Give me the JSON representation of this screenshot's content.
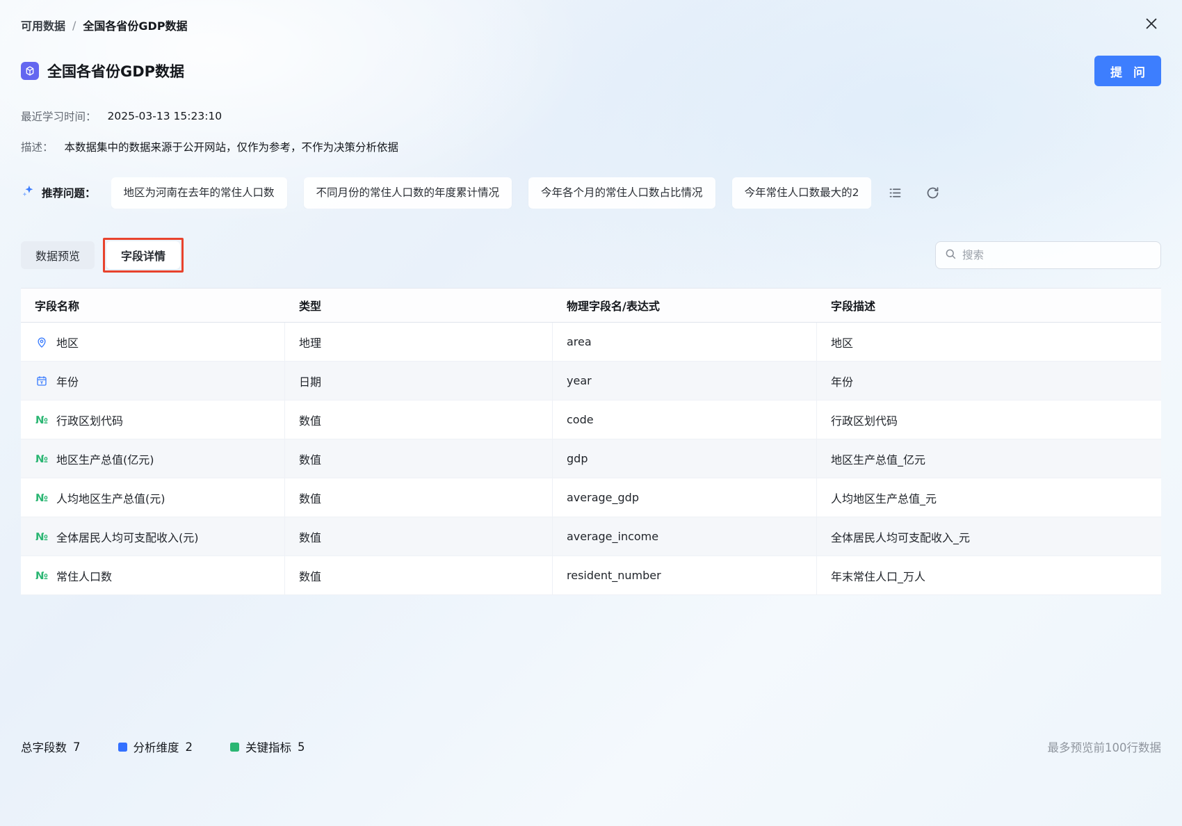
{
  "breadcrumb": {
    "parent": "可用数据",
    "separator": "/",
    "current": "全国各省份GDP数据"
  },
  "header": {
    "title": "全国各省份GDP数据",
    "ask_button": "提 问",
    "learn_time_label": "最近学习时间：",
    "learn_time_value": "2025-03-13 15:23:10",
    "desc_label": "描述：",
    "desc_value": "本数据集中的数据来源于公开网站，仅作为参考，不作为决策分析依据"
  },
  "recommend": {
    "label": "推荐问题：",
    "chips": [
      "地区为河南在去年的常住人口数",
      "不同月份的常住人口数的年度累计情况",
      "今年各个月的常住人口数占比情况",
      "今年常住人口数最大的2"
    ]
  },
  "tabs": [
    {
      "label": "数据预览",
      "active": false
    },
    {
      "label": "字段详情",
      "active": true
    }
  ],
  "search": {
    "placeholder": "搜索"
  },
  "table": {
    "headers": [
      "字段名称",
      "类型",
      "物理字段名/表达式",
      "字段描述"
    ],
    "rows": [
      {
        "icon": "location-pin",
        "name": "地区",
        "type": "地理",
        "physical": "area",
        "desc": "地区"
      },
      {
        "icon": "calendar",
        "name": "年份",
        "type": "日期",
        "physical": "year",
        "desc": "年份"
      },
      {
        "icon": "numeric",
        "name": "行政区划代码",
        "type": "数值",
        "physical": "code",
        "desc": "行政区划代码"
      },
      {
        "icon": "numeric",
        "name": "地区生产总值(亿元)",
        "type": "数值",
        "physical": "gdp",
        "desc": "地区生产总值_亿元"
      },
      {
        "icon": "numeric",
        "name": "人均地区生产总值(元)",
        "type": "数值",
        "physical": "average_gdp",
        "desc": "人均地区生产总值_元"
      },
      {
        "icon": "numeric",
        "name": "全体居民人均可支配收入(元)",
        "type": "数值",
        "physical": "average_income",
        "desc": "全体居民人均可支配收入_元"
      },
      {
        "icon": "numeric",
        "name": "常住人口数",
        "type": "数值",
        "physical": "resident_number",
        "desc": "年末常住人口_万人"
      }
    ]
  },
  "footer": {
    "total_label": "总字段数",
    "total_value": "7",
    "dimension_label": "分析维度",
    "dimension_value": "2",
    "metric_label": "关键指标",
    "metric_value": "5",
    "preview_note": "最多预览前100行数据"
  },
  "colors": {
    "accent_blue": "#3d7efe",
    "dataset_icon_purple": "#6467f0",
    "numeric_green": "#2bb673",
    "dimension_square_blue": "#3370ff",
    "metric_square_green": "#2bb673",
    "annotation_red": "#e8432d"
  }
}
